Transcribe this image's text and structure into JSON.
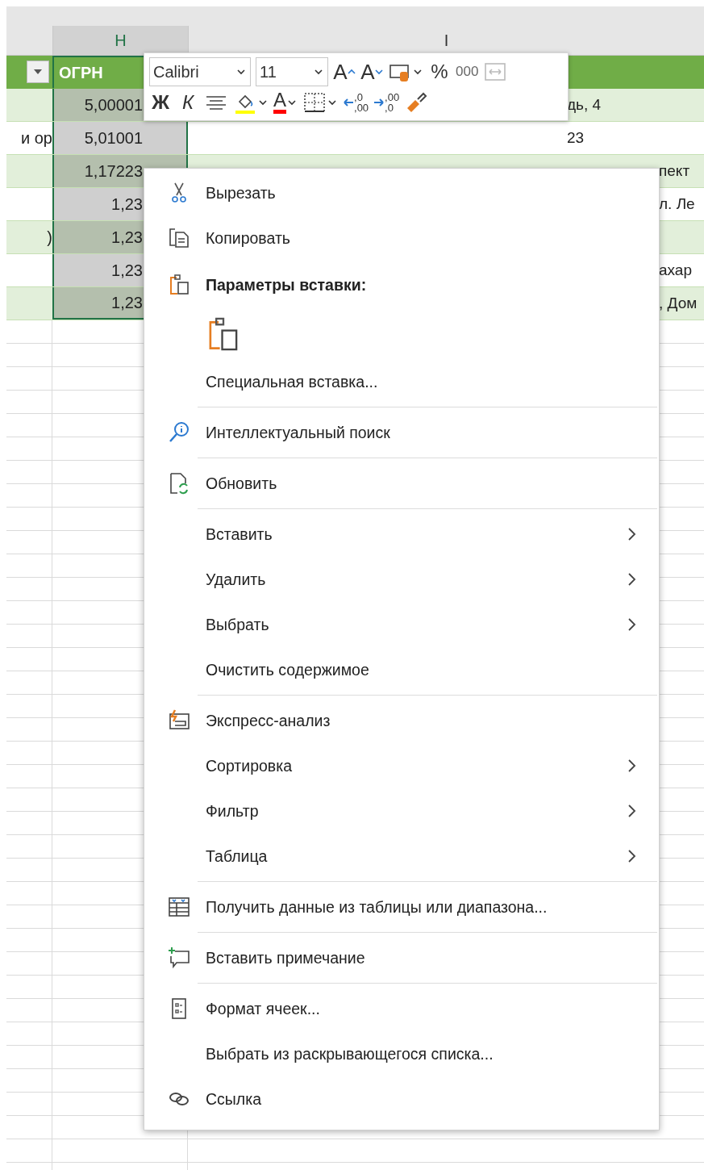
{
  "sheet": {
    "columns": [
      {
        "label": "H",
        "selected": true
      },
      {
        "label": "I",
        "selected": false
      }
    ],
    "table_header": {
      "title": "ОГРН"
    },
    "rows": [
      {
        "col_g": "",
        "col_h": "5,00001",
        "col_i": "дь, 4"
      },
      {
        "col_g": "и ор",
        "col_h": "5,01001",
        "col_i": "23"
      },
      {
        "col_g": "",
        "col_h": "1,17223",
        "col_i": "пект"
      },
      {
        "col_g": "",
        "col_h": "1,23",
        "col_i": "л. Ле"
      },
      {
        "col_g": ")",
        "col_h": "1,23",
        "col_i": ""
      },
      {
        "col_g": "",
        "col_h": "1,23",
        "col_i": "ахар"
      },
      {
        "col_g": "",
        "col_h": "1,23",
        "col_i": ", Дом"
      }
    ]
  },
  "mini_toolbar": {
    "font": "Calibri",
    "size": "11",
    "row_1": [
      {
        "kind": "grow",
        "text": "A"
      },
      {
        "kind": "shrink",
        "text": "A"
      },
      {
        "kind": "number-format"
      },
      {
        "kind": "percent",
        "text": "%"
      },
      {
        "kind": "thousands",
        "text": "000"
      },
      {
        "kind": "merge",
        "disabled": true
      }
    ],
    "row_2": [
      {
        "kind": "bold",
        "text": "Ж"
      },
      {
        "kind": "italic",
        "text": "К"
      },
      {
        "kind": "align"
      },
      {
        "kind": "fill",
        "color": "#ffff00"
      },
      {
        "kind": "font-color",
        "text": "A",
        "color": "#ff0000"
      },
      {
        "kind": "borders"
      },
      {
        "kind": "more-decimals",
        "digits": [
          ",0",
          ",00"
        ]
      },
      {
        "kind": "fewer-decimals",
        "digits": [
          ",00",
          ",0"
        ]
      },
      {
        "kind": "painter"
      }
    ]
  },
  "context_menu": {
    "groups": [
      [
        {
          "kind": "cut",
          "label": "Вырезать",
          "submenu": false
        },
        {
          "kind": "copy",
          "label": "Копировать",
          "submenu": false
        },
        {
          "kind": "paste-heading",
          "label": "Параметры вставки:",
          "submenu": false
        },
        {
          "kind": "paste-button"
        },
        {
          "kind": "plain",
          "label": "Специальная вставка...",
          "submenu": false
        }
      ],
      [
        {
          "kind": "lookup",
          "label": "Интеллектуальный поиск",
          "submenu": false
        }
      ],
      [
        {
          "kind": "refresh",
          "label": "Обновить",
          "submenu": false
        }
      ],
      [
        {
          "kind": "plain",
          "label": "Вставить",
          "submenu": true
        },
        {
          "kind": "plain",
          "label": "Удалить",
          "submenu": true
        },
        {
          "kind": "plain",
          "label": "Выбрать",
          "submenu": true
        },
        {
          "kind": "plain",
          "label": "Очистить содержимое",
          "submenu": false
        }
      ],
      [
        {
          "kind": "analysis",
          "label": "Экспресс-анализ",
          "submenu": false
        },
        {
          "kind": "plain",
          "label": "Сортировка",
          "submenu": true
        },
        {
          "kind": "plain",
          "label": "Фильтр",
          "submenu": true
        },
        {
          "kind": "plain",
          "label": "Таблица",
          "submenu": true
        }
      ],
      [
        {
          "kind": "get-data",
          "label": "Получить данные из таблицы или диапазона...",
          "submenu": false
        }
      ],
      [
        {
          "kind": "comment",
          "label": "Вставить примечание",
          "submenu": false
        }
      ],
      [
        {
          "kind": "format",
          "label": "Формат ячеек...",
          "submenu": false
        },
        {
          "kind": "plain",
          "label": "Выбрать из раскрывающегося списка...",
          "submenu": false
        },
        {
          "kind": "link",
          "label": "Ссылка",
          "submenu": false
        }
      ]
    ]
  }
}
